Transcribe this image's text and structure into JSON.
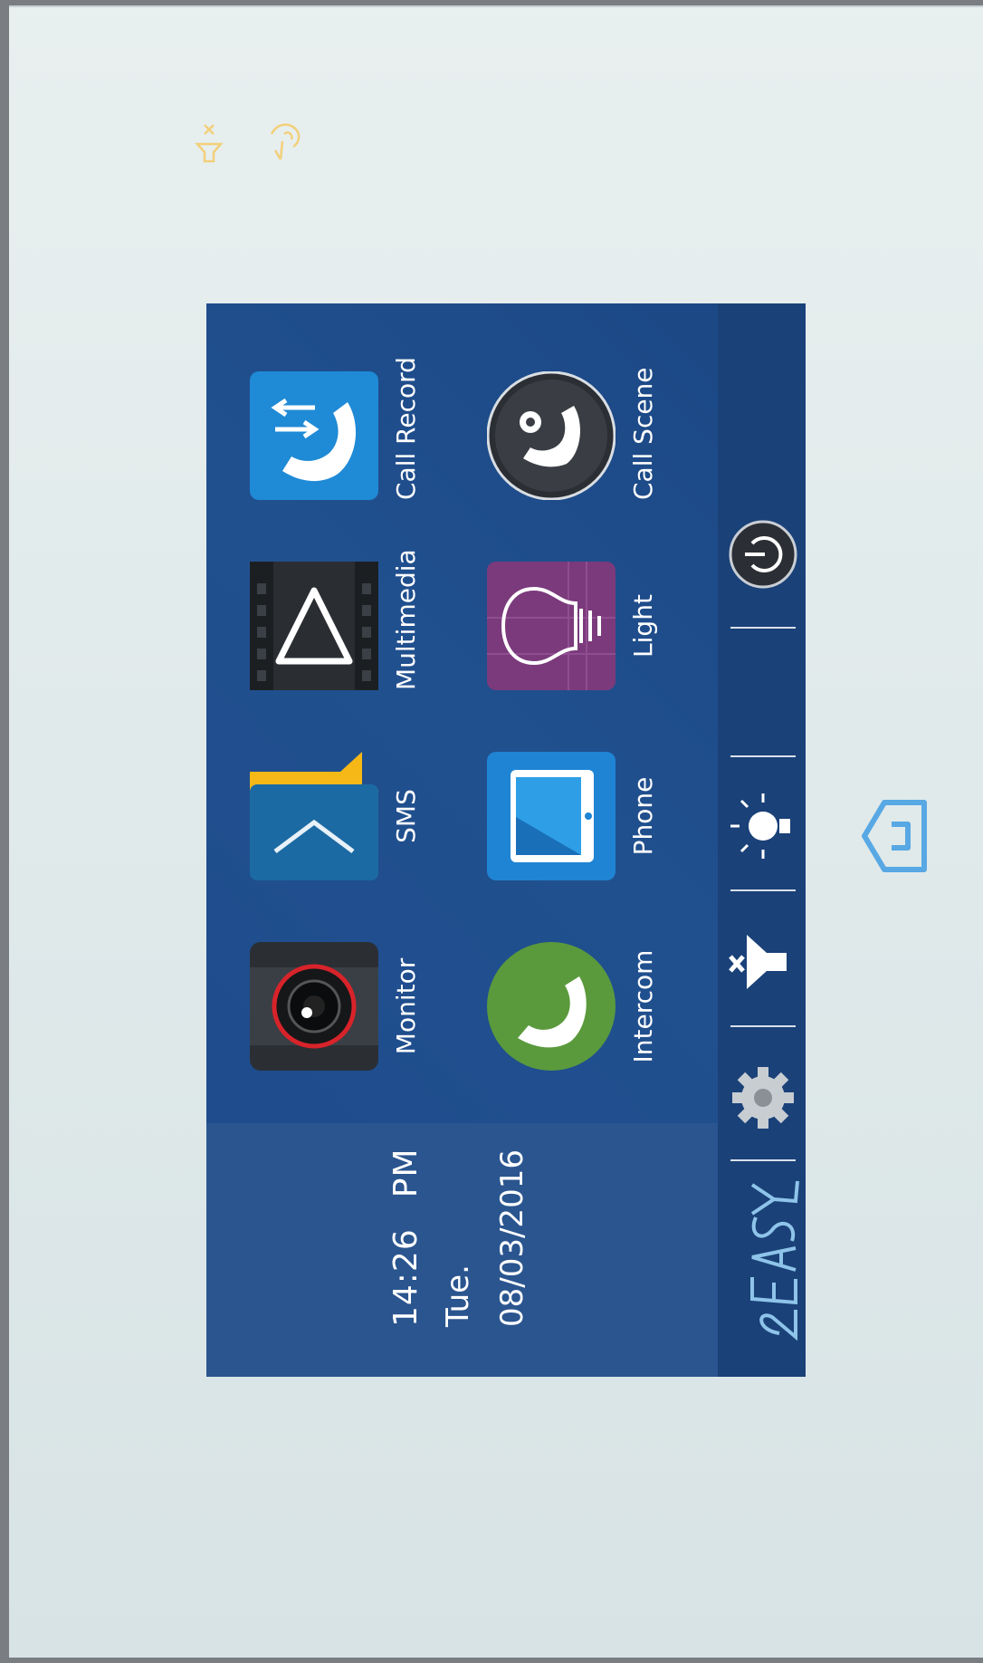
{
  "clock": {
    "time": "14:26",
    "ampm": "PM",
    "day": "Tue.",
    "date": "08/03/2016"
  },
  "apps": [
    {
      "label": "Monitor",
      "icon": "camera-lens-icon"
    },
    {
      "label": "SMS",
      "icon": "folder-chevron-icon"
    },
    {
      "label": "Multimedia",
      "icon": "play-triangle-icon"
    },
    {
      "label": "Call Record",
      "icon": "phone-arrows-icon"
    },
    {
      "label": "Intercom",
      "icon": "phone-handset-icon"
    },
    {
      "label": "Phone",
      "icon": "mobile-phone-icon"
    },
    {
      "label": "Light",
      "icon": "light-bulb-icon"
    },
    {
      "label": "Call Scene",
      "icon": "phone-gear-icon"
    }
  ],
  "bottom_bar": {
    "logo": "2EASY",
    "icons": [
      "settings-gear-icon",
      "mute-speaker-icon",
      "brightness-icon",
      "power-icon"
    ]
  },
  "hardware": {
    "indicators": [
      "mute-indicator-icon",
      "unlock-indicator-icon"
    ],
    "home_key": "home-key-icon"
  },
  "colors": {
    "screen_bg": "#1f4e8f",
    "bar_bg": "#1a4178",
    "intercom_green": "#5a9a3c",
    "light_purple": "#7b3a7c",
    "accent_blue": "#1f8ad6",
    "sms_yellow": "#f6b817"
  }
}
